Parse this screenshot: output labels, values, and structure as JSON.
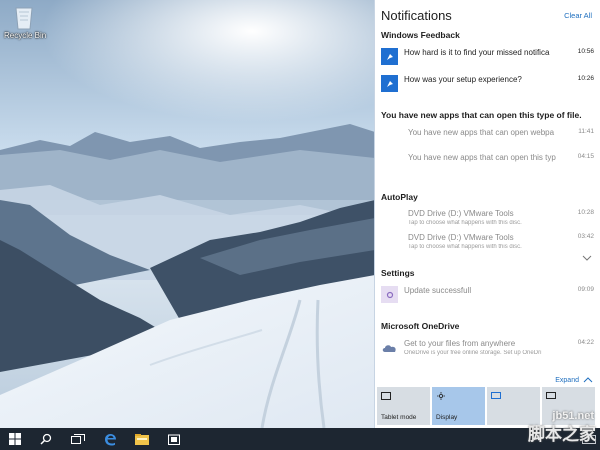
{
  "desktop": {
    "recycle_bin_label": "Recycle Bin",
    "recycle_bin_icon": "recycle-bin-icon"
  },
  "action_center": {
    "title": "Notifications",
    "clear_all": "Clear All",
    "groups": [
      {
        "title": "Windows Feedback",
        "items": [
          {
            "text": "How hard is it to find your missed notifica",
            "time": "10:56",
            "icon": "feedback-icon"
          },
          {
            "text": "How was your setup experience?",
            "time": "10:26",
            "icon": "feedback-icon"
          }
        ]
      },
      {
        "title": "You have new apps that can open this type of file.",
        "items": [
          {
            "text": "You have new apps that can open webpa",
            "time": "11:41"
          },
          {
            "text": "You have new apps that can open this typ",
            "time": "04:15"
          }
        ]
      },
      {
        "title": "AutoPlay",
        "items": [
          {
            "text": "DVD Drive (D:) VMware Tools",
            "sub": "Tap to choose what happens with this disc.",
            "time": "10:28"
          },
          {
            "text": "DVD Drive (D:) VMware Tools",
            "sub": "Tap to choose what happens with this disc.",
            "time": "03:42"
          }
        ]
      },
      {
        "title": "Settings",
        "items": [
          {
            "text": "Update successfull",
            "time": "09:09",
            "icon": "settings-gear-icon"
          }
        ]
      },
      {
        "title": "Microsoft OneDrive",
        "items": [
          {
            "text": "Get to your files from anywhere",
            "sub": "OneDrive is your free online storage. Set up OneDri",
            "time": "04:22",
            "icon": "onedrive-cloud-icon"
          }
        ]
      }
    ],
    "expand": "Expand",
    "quick_actions": [
      {
        "label": "Tablet mode",
        "icon": "tablet-mode-icon",
        "active": false
      },
      {
        "label": "Display",
        "icon": "brightness-icon",
        "active": true
      },
      {
        "label": "",
        "icon": "project-icon",
        "active": false
      },
      {
        "label": "",
        "icon": "connect-icon",
        "active": false
      }
    ]
  },
  "taskbar": {
    "start_icon": "windows-start-icon",
    "search_icon": "search-icon",
    "task_view_icon": "task-view-icon",
    "edge_icon": "edge-browser-icon",
    "explorer_icon": "file-explorer-icon",
    "store_icon": "store-icon",
    "keyboard_icon": "keyboard-icon"
  },
  "watermark": {
    "site": "jb51.net",
    "text": "脚本之家"
  },
  "colors": {
    "accent": "#1f6fd1",
    "link": "#1f6fbf",
    "taskbar": "#1d2631",
    "tile_active": "#a7c7ea"
  }
}
